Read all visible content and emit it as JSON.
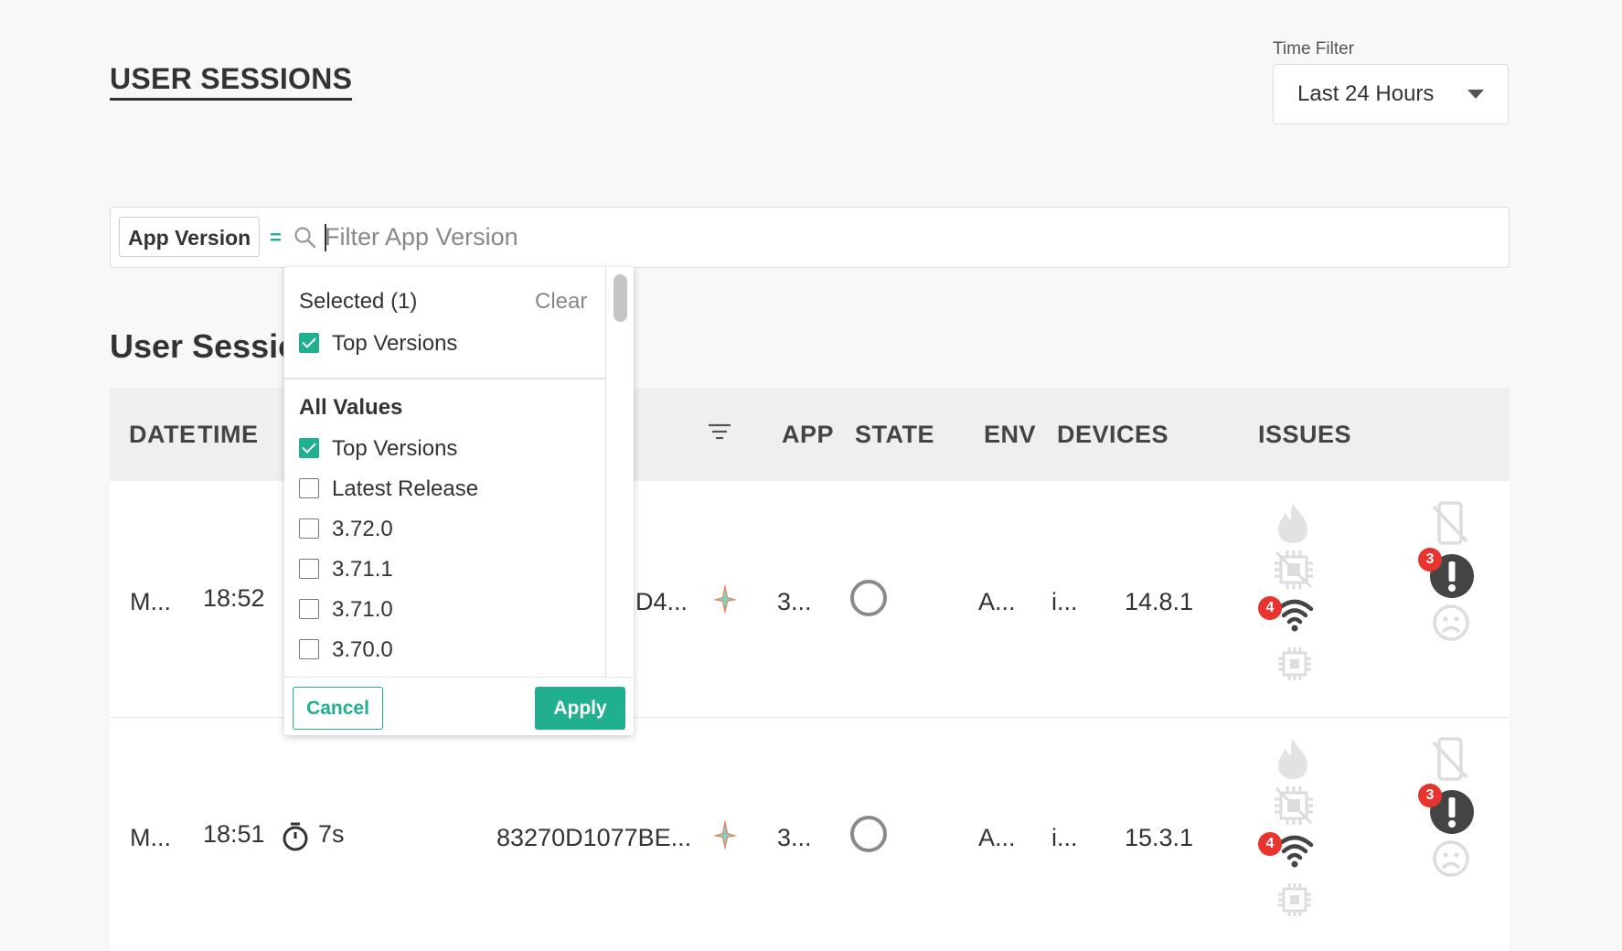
{
  "page": {
    "title": "USER SESSIONS"
  },
  "time_filter": {
    "label": "Time Filter",
    "value": "Last 24 Hours"
  },
  "filter": {
    "field_label": "App Version",
    "operator": "=",
    "placeholder": "Filter App Version"
  },
  "section": {
    "title": "User Sessions"
  },
  "table": {
    "headers": {
      "date": "DATE",
      "time": "TIME",
      "app": "APP",
      "state": "STATE",
      "env": "ENV",
      "devices": "DEVICES",
      "issues": "ISSUES"
    },
    "rows": [
      {
        "date": "M...",
        "time": "18:52",
        "session_id": "D4...",
        "app_version": "3...",
        "env": "A...",
        "device": "i...",
        "os_version": "14.8.1",
        "network_badge": "4",
        "error_badge": "3"
      },
      {
        "date": "M...",
        "time": "18:51",
        "duration": "7s",
        "session_id": "83270D1077BE...",
        "app_version": "3...",
        "env": "A...",
        "device": "i...",
        "os_version": "15.3.1",
        "network_badge": "4",
        "error_badge": "3"
      }
    ]
  },
  "dropdown": {
    "selected_heading": "Selected (1)",
    "clear_label": "Clear",
    "selected_items": [
      {
        "label": "Top Versions",
        "checked": true
      }
    ],
    "all_values_heading": "All Values",
    "options": [
      {
        "label": "Top Versions",
        "checked": true
      },
      {
        "label": "Latest Release",
        "checked": false
      },
      {
        "label": "3.72.0",
        "checked": false
      },
      {
        "label": "3.71.1",
        "checked": false
      },
      {
        "label": "3.71.0",
        "checked": false
      },
      {
        "label": "3.70.0",
        "checked": false
      }
    ],
    "cancel_label": "Cancel",
    "apply_label": "Apply"
  },
  "icons": {
    "accent": "#20b08e",
    "badge_color": "#e8332f",
    "names": [
      "search-icon",
      "filter-lines-icon",
      "app-logo-icon",
      "state-ring-icon",
      "fire-icon",
      "cpu-crossed-icon",
      "wifi-icon",
      "chip-icon",
      "phone-crossed-icon",
      "exclamation-icon",
      "sad-face-icon",
      "stopwatch-icon"
    ]
  }
}
